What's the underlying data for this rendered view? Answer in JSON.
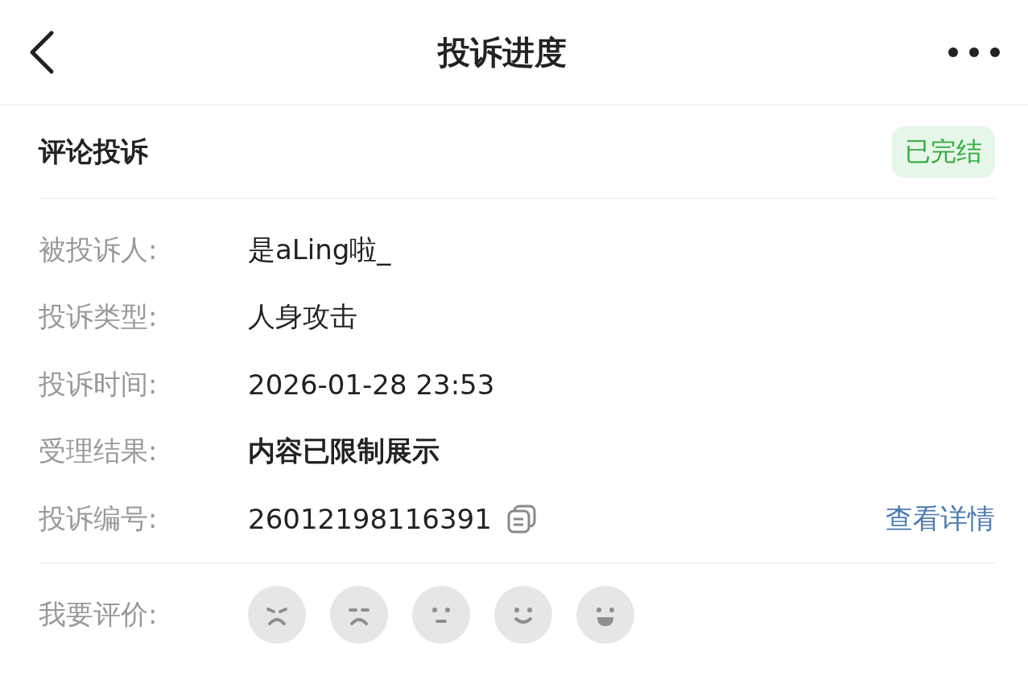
{
  "header": {
    "title": "投诉进度"
  },
  "card": {
    "title": "评论投诉",
    "status": "已完结",
    "fields": [
      {
        "kind": "text",
        "label": "被投诉人:",
        "value": "是aLing啦_"
      },
      {
        "kind": "text",
        "label": "投诉类型:",
        "value": "人身攻击"
      },
      {
        "kind": "text",
        "label": "投诉时间:",
        "value": "2026-01-28 23:53"
      },
      {
        "kind": "bold",
        "label": "受理结果:",
        "value": "内容已限制展示"
      },
      {
        "kind": "id",
        "label": "投诉编号:",
        "value": "26012198116391",
        "link": "查看详情"
      }
    ],
    "rating": {
      "label": "我要评价:",
      "faces": [
        {
          "kind": "angry",
          "selected": false
        },
        {
          "kind": "sad",
          "selected": false
        },
        {
          "kind": "neutral",
          "selected": false
        },
        {
          "kind": "smile",
          "selected": false
        },
        {
          "kind": "laugh",
          "selected": false
        }
      ]
    }
  }
}
